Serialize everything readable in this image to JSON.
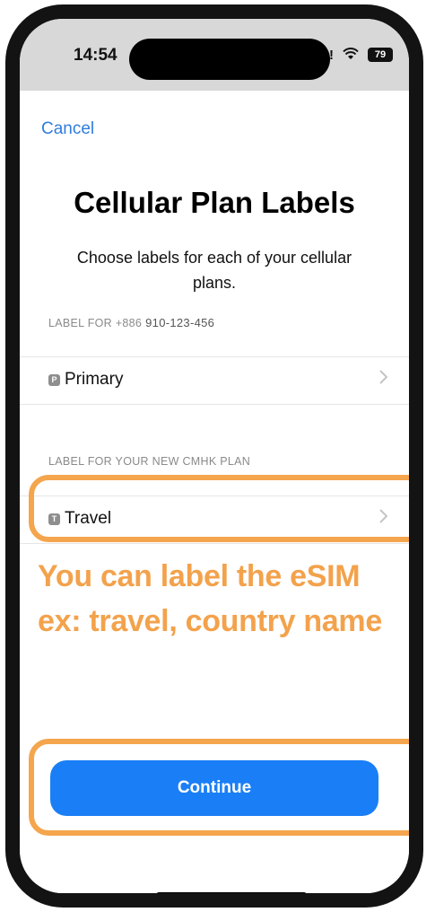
{
  "status_bar": {
    "time": "14:54",
    "battery": "79"
  },
  "sheet": {
    "cancel_label": "Cancel",
    "title": "Cellular Plan Labels",
    "subtitle": "Choose labels for each of your cellular plans.",
    "sections": [
      {
        "header": "LABEL FOR +886",
        "number": "910-123-456",
        "badge": "P",
        "label": "Primary"
      },
      {
        "header": "LABEL FOR YOUR NEW CMHK PLAN",
        "number": "",
        "badge": "T",
        "label": "Travel"
      }
    ],
    "continue_label": "Continue"
  },
  "annotation": {
    "line1": "You can label the eSIM",
    "line2": "ex: travel, country name"
  },
  "colors": {
    "accent": "#1a7ff6",
    "link": "#2f7ddb",
    "highlight": "#f4a54d"
  },
  "icons": {
    "chevron": "chevron-right-icon",
    "wifi": "wifi-icon",
    "signal": "signal-icon",
    "battery": "battery-icon"
  }
}
